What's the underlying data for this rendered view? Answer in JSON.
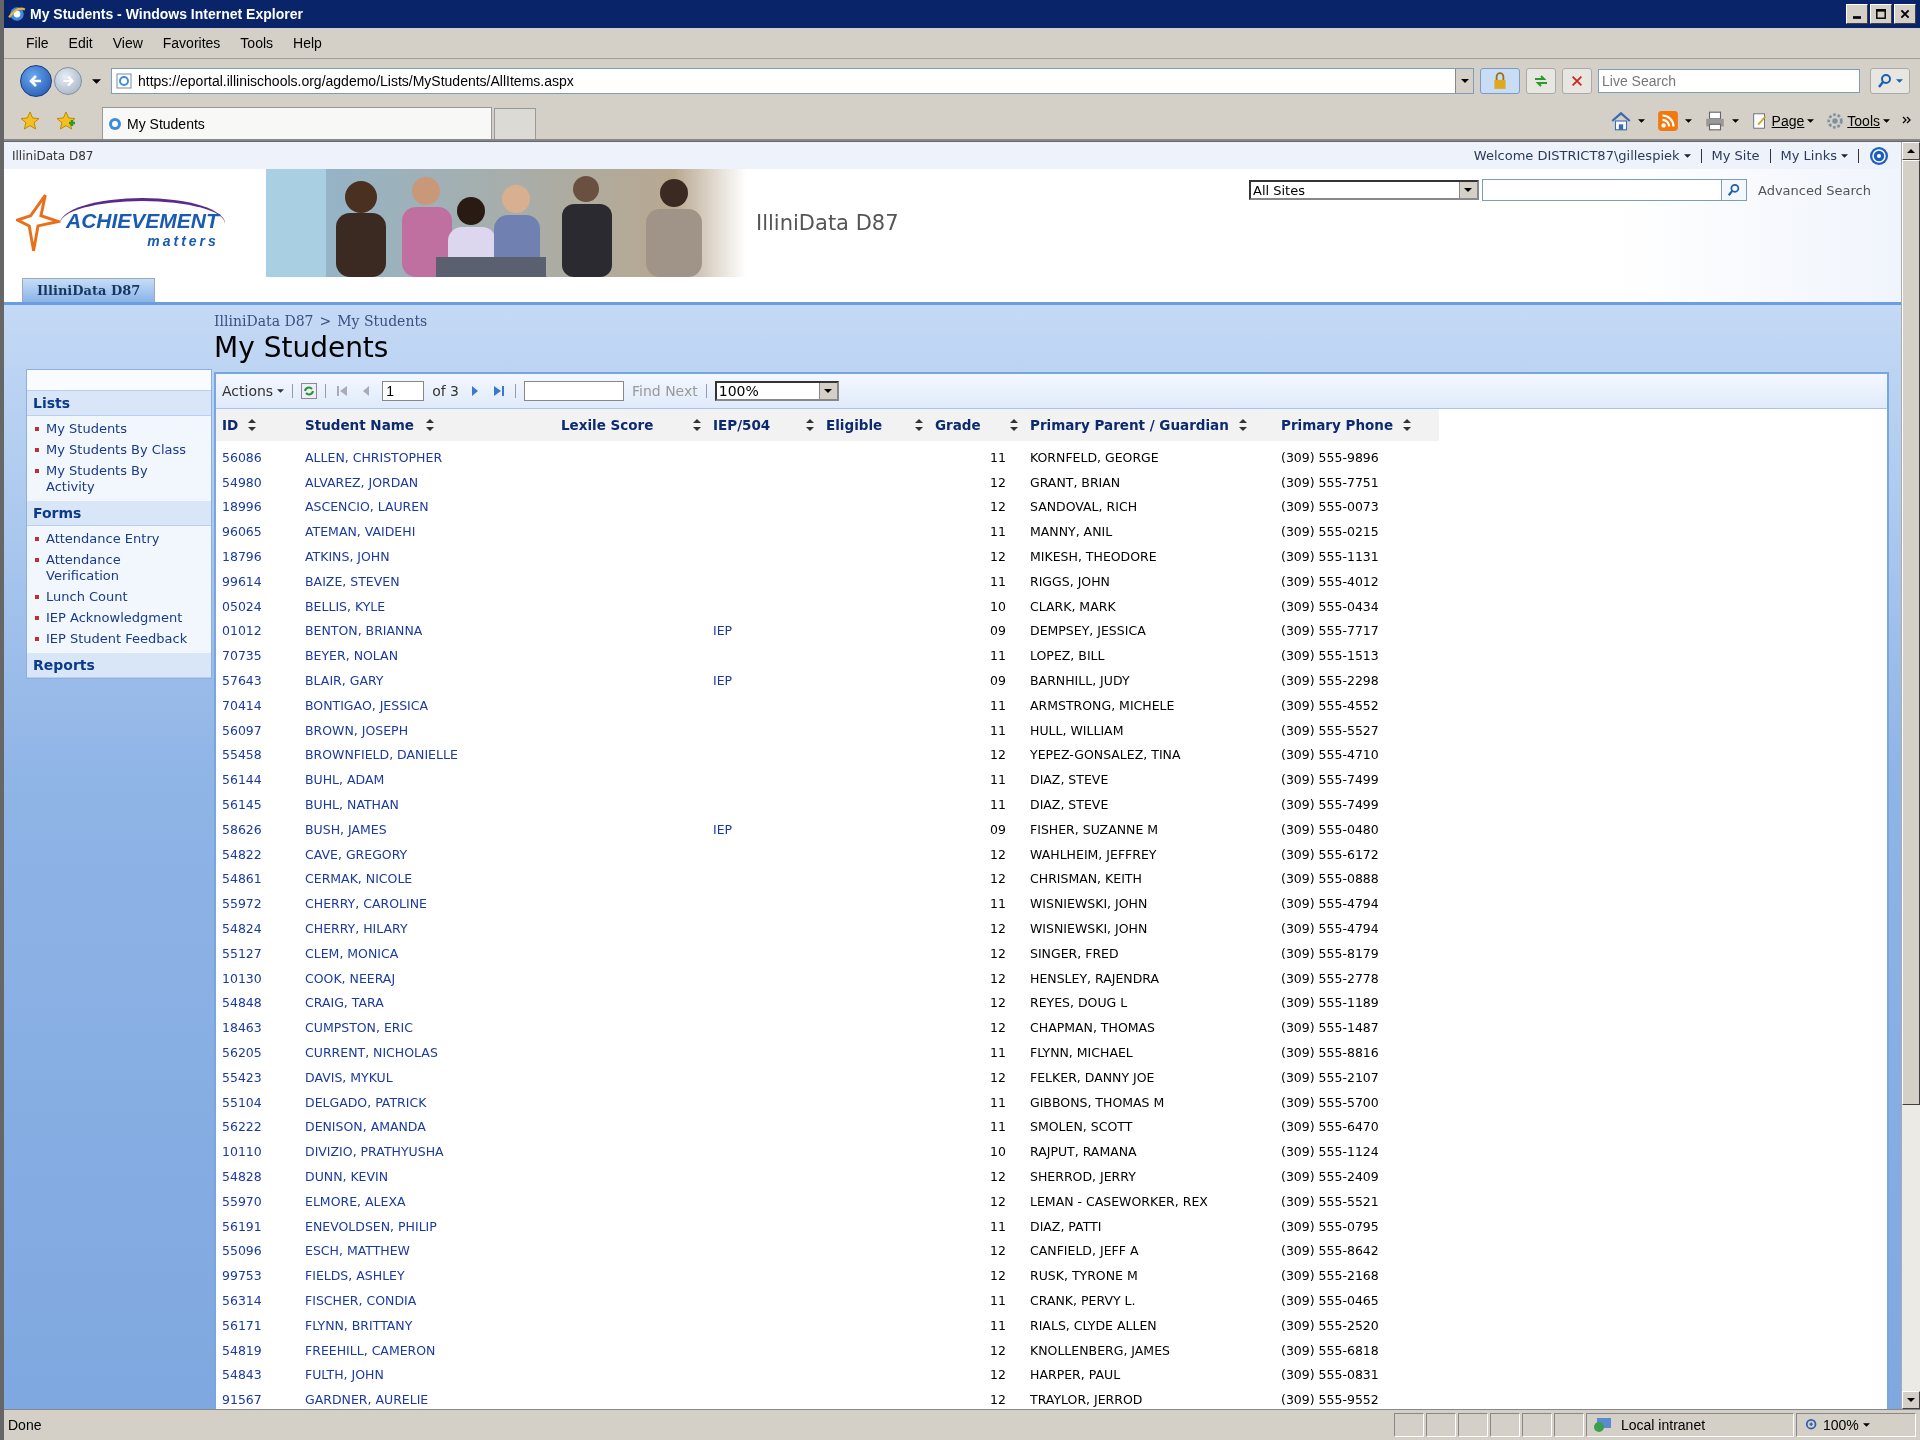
{
  "window": {
    "title": "My Students - Windows Internet Explorer"
  },
  "menu": [
    "File",
    "Edit",
    "View",
    "Favorites",
    "Tools",
    "Help"
  ],
  "address": {
    "url": "https://eportal.illinischools.org/agdemo/Lists/MyStudents/AllItems.aspx"
  },
  "browser_search": {
    "placeholder": "Live Search"
  },
  "tab": {
    "title": "My Students",
    "selected": true
  },
  "command_bar": [
    "Page",
    "Tools"
  ],
  "site_bar": {
    "site": "IlliniData D87",
    "welcome": "Welcome DISTRICT87\\gillespiek",
    "links": [
      "My Site",
      "My Links"
    ]
  },
  "header": {
    "logo": [
      "ACHIEVEMENT",
      "matters"
    ],
    "title": "IlliniData D87",
    "scope": "All Sites",
    "advanced": "Advanced Search",
    "nav_tabs": [
      {
        "label": "IlliniData D87",
        "selected": true
      }
    ]
  },
  "breadcrumb": {
    "items": [
      "IlliniData D87",
      "My Students"
    ],
    "separator": ">"
  },
  "page_title": "My Students",
  "sidebar": [
    {
      "heading": "Lists",
      "items": [
        "My Students",
        "My Students By Class",
        "My Students By Activity"
      ]
    },
    {
      "heading": "Forms",
      "items": [
        "Attendance Entry",
        "Attendance Verification",
        "Lunch Count",
        "IEP Acknowledgment",
        "IEP Student Feedback"
      ]
    },
    {
      "heading": "Reports"
    }
  ],
  "toolbar": {
    "actions": "Actions",
    "page": "1",
    "of": "of 3",
    "find": "Find Next",
    "zoom": "100%"
  },
  "table": {
    "columns": [
      "ID",
      "Student Name",
      "Lexile Score",
      "IEP/504",
      "Eligible",
      "Grade",
      "Primary Parent / Guardian",
      "Primary Phone"
    ],
    "rows": [
      {
        "id": "56086",
        "name": "ALLEN, CHRISTOPHER",
        "grade": "11",
        "parent": "KORNFELD, GEORGE",
        "phone": "(309) 555-9896"
      },
      {
        "id": "54980",
        "name": "ALVAREZ, JORDAN",
        "grade": "12",
        "parent": "GRANT, BRIAN",
        "phone": "(309) 555-7751"
      },
      {
        "id": "18996",
        "name": "ASCENCIO, LAUREN",
        "grade": "12",
        "parent": "SANDOVAL, RICH",
        "phone": "(309) 555-0073"
      },
      {
        "id": "96065",
        "name": "ATEMAN, VAIDEHI",
        "grade": "11",
        "parent": "MANNY, ANIL",
        "phone": "(309) 555-0215"
      },
      {
        "id": "18796",
        "name": "ATKINS, JOHN",
        "grade": "12",
        "parent": "MIKESH, THEODORE",
        "phone": "(309) 555-1131"
      },
      {
        "id": "99614",
        "name": "BAIZE, STEVEN",
        "grade": "11",
        "parent": "RIGGS, JOHN",
        "phone": "(309) 555-4012"
      },
      {
        "id": "05024",
        "name": "BELLIS, KYLE",
        "grade": "10",
        "parent": "CLARK, MARK",
        "phone": "(309) 555-0434"
      },
      {
        "id": "01012",
        "name": "BENTON, BRIANNA",
        "iep": "IEP",
        "grade": "09",
        "parent": "DEMPSEY, JESSICA",
        "phone": "(309) 555-7717"
      },
      {
        "id": "70735",
        "name": "BEYER, NOLAN",
        "grade": "11",
        "parent": "LOPEZ, BILL",
        "phone": "(309) 555-1513"
      },
      {
        "id": "57643",
        "name": "BLAIR, GARY",
        "iep": "IEP",
        "grade": "09",
        "parent": "BARNHILL, JUDY",
        "phone": "(309) 555-2298"
      },
      {
        "id": "70414",
        "name": "BONTIGAO, JESSICA",
        "grade": "11",
        "parent": "ARMSTRONG, MICHELE",
        "phone": "(309) 555-4552"
      },
      {
        "id": "56097",
        "name": "BROWN, JOSEPH",
        "grade": "11",
        "parent": "HULL, WILLIAM",
        "phone": "(309) 555-5527"
      },
      {
        "id": "55458",
        "name": "BROWNFIELD, DANIELLE",
        "grade": "12",
        "parent": "YEPEZ-GONSALEZ, TINA",
        "phone": "(309) 555-4710"
      },
      {
        "id": "56144",
        "name": "BUHL, ADAM",
        "grade": "11",
        "parent": "DIAZ, STEVE",
        "phone": "(309) 555-7499"
      },
      {
        "id": "56145",
        "name": "BUHL, NATHAN",
        "grade": "11",
        "parent": "DIAZ, STEVE",
        "phone": "(309) 555-7499"
      },
      {
        "id": "58626",
        "name": "BUSH, JAMES",
        "iep": "IEP",
        "grade": "09",
        "parent": "FISHER, SUZANNE M",
        "phone": "(309) 555-0480"
      },
      {
        "id": "54822",
        "name": "CAVE, GREGORY",
        "grade": "12",
        "parent": "WAHLHEIM, JEFFREY",
        "phone": "(309) 555-6172"
      },
      {
        "id": "54861",
        "name": "CERMAK, NICOLE",
        "grade": "12",
        "parent": "CHRISMAN, KEITH",
        "phone": "(309) 555-0888"
      },
      {
        "id": "55972",
        "name": "CHERRY, CAROLINE",
        "grade": "11",
        "parent": "WISNIEWSKI, JOHN",
        "phone": "(309) 555-4794"
      },
      {
        "id": "54824",
        "name": "CHERRY, HILARY",
        "grade": "12",
        "parent": "WISNIEWSKI, JOHN",
        "phone": "(309) 555-4794"
      },
      {
        "id": "55127",
        "name": "CLEM, MONICA",
        "grade": "12",
        "parent": "SINGER, FRED",
        "phone": "(309) 555-8179"
      },
      {
        "id": "10130",
        "name": "COOK, NEERAJ",
        "grade": "12",
        "parent": "HENSLEY, RAJENDRA",
        "phone": "(309) 555-2778"
      },
      {
        "id": "54848",
        "name": "CRAIG, TARA",
        "grade": "12",
        "parent": "REYES, DOUG L",
        "phone": "(309) 555-1189"
      },
      {
        "id": "18463",
        "name": "CUMPSTON, ERIC",
        "grade": "12",
        "parent": "CHAPMAN, THOMAS",
        "phone": "(309) 555-1487"
      },
      {
        "id": "56205",
        "name": "CURRENT, NICHOLAS",
        "grade": "11",
        "parent": "FLYNN, MICHAEL",
        "phone": "(309) 555-8816"
      },
      {
        "id": "55423",
        "name": "DAVIS, MYKUL",
        "grade": "12",
        "parent": "FELKER, DANNY JOE",
        "phone": "(309) 555-2107"
      },
      {
        "id": "55104",
        "name": "DELGADO, PATRICK",
        "grade": "11",
        "parent": "GIBBONS, THOMAS M",
        "phone": "(309) 555-5700"
      },
      {
        "id": "56222",
        "name": "DENISON, AMANDA",
        "grade": "11",
        "parent": "SMOLEN, SCOTT",
        "phone": "(309) 555-6470"
      },
      {
        "id": "10110",
        "name": "DIVIZIO, PRATHYUSHA",
        "grade": "10",
        "parent": "RAJPUT, RAMANA",
        "phone": "(309) 555-1124"
      },
      {
        "id": "54828",
        "name": "DUNN, KEVIN",
        "grade": "12",
        "parent": "SHERROD, JERRY",
        "phone": "(309) 555-2409"
      },
      {
        "id": "55970",
        "name": "ELMORE, ALEXA",
        "grade": "12",
        "parent": "LEMAN - CASEWORKER, REX",
        "phone": "(309) 555-5521"
      },
      {
        "id": "56191",
        "name": "ENEVOLDSEN, PHILIP",
        "grade": "11",
        "parent": "DIAZ, PATTI",
        "phone": "(309) 555-0795"
      },
      {
        "id": "55096",
        "name": "ESCH, MATTHEW",
        "grade": "12",
        "parent": "CANFIELD, JEFF A",
        "phone": "(309) 555-8642"
      },
      {
        "id": "99753",
        "name": "FIELDS, ASHLEY",
        "grade": "12",
        "parent": "RUSK, TYRONE M",
        "phone": "(309) 555-2168"
      },
      {
        "id": "56314",
        "name": "FISCHER, CONDIA",
        "grade": "11",
        "parent": "CRANK, PERVY L.",
        "phone": "(309) 555-0465"
      },
      {
        "id": "56171",
        "name": "FLYNN, BRITTANY",
        "grade": "11",
        "parent": "RIALS, CLYDE ALLEN",
        "phone": "(309) 555-2520"
      },
      {
        "id": "54819",
        "name": "FREEHILL, CAMERON",
        "grade": "12",
        "parent": "KNOLLENBERG, JAMES",
        "phone": "(309) 555-6818"
      },
      {
        "id": "54843",
        "name": "FULTH, JOHN",
        "grade": "12",
        "parent": "HARPER, PAUL",
        "phone": "(309) 555-0831"
      },
      {
        "id": "91567",
        "name": "GARDNER, AURELIE",
        "grade": "12",
        "parent": "TRAYLOR, JERROD",
        "phone": "(309) 555-9552"
      }
    ]
  },
  "status_bar": {
    "text": "Done",
    "zone": "Local intranet",
    "zoom": "100%"
  }
}
